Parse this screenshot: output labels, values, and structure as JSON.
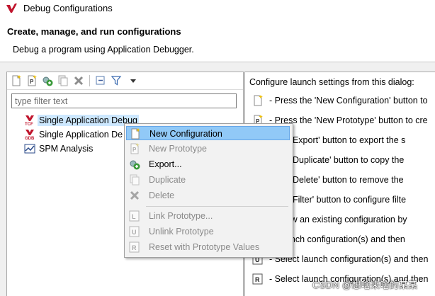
{
  "window": {
    "title": "Debug Configurations"
  },
  "header": {
    "title": "Create, manage, and run configurations",
    "subtitle": "Debug a program using Application Debugger."
  },
  "toolbar": {
    "icons": [
      "new-configuration-icon",
      "new-prototype-icon",
      "export-icon",
      "duplicate-icon",
      "delete-icon",
      "collapse-all-icon",
      "filter-icon",
      "view-menu-icon"
    ]
  },
  "filter": {
    "placeholder": "type filter text",
    "value": ""
  },
  "tree": {
    "items": [
      {
        "label": "Single Application Debug",
        "icon": "tcf-launch-icon",
        "selected": true
      },
      {
        "label": "Single Application De",
        "icon": "gdb-launch-icon",
        "selected": false
      },
      {
        "label": "SPM Analysis",
        "icon": "chart-icon",
        "selected": false
      }
    ]
  },
  "context_menu": {
    "items": [
      {
        "label": "New Configuration",
        "icon": "new-configuration-icon",
        "enabled": true,
        "highlighted": true
      },
      {
        "label": "New Prototype",
        "icon": "new-prototype-icon",
        "enabled": false
      },
      {
        "label": "Export...",
        "icon": "export-icon",
        "enabled": true
      },
      {
        "label": "Duplicate",
        "icon": "duplicate-icon",
        "enabled": false
      },
      {
        "label": "Delete",
        "icon": "delete-icon",
        "enabled": false
      },
      {
        "label": "Link Prototype...",
        "icon": "link-prototype-icon",
        "enabled": false
      },
      {
        "label": "Unlink Prototype",
        "icon": "unlink-prototype-icon",
        "enabled": false
      },
      {
        "label": "Reset with Prototype Values",
        "icon": "reset-prototype-icon",
        "enabled": false
      }
    ]
  },
  "help": {
    "heading": "Configure launch settings from this dialog:",
    "lines": [
      {
        "text": "- Press the 'New Configuration' button to",
        "icon": "new-configuration-icon"
      },
      {
        "text": "- Press the 'New Prototype' button to cre",
        "icon": "new-prototype-icon"
      },
      {
        "text": "s the 'Export' button to export the s",
        "icon": "export-icon"
      },
      {
        "text": "s the 'Duplicate' button to copy the",
        "icon": "duplicate-icon"
      },
      {
        "text": "s the 'Delete' button to remove the",
        "icon": "delete-icon"
      },
      {
        "text": "s the 'Filter' button to configure filte",
        "icon": "filter-icon"
      },
      {
        "text": "or view an existing configuration by",
        "icon": "edit-icon"
      },
      {
        "text": "ct launch configuration(s) and then",
        "icon": "link-prototype-icon"
      },
      {
        "text": "- Select launch configuration(s) and then",
        "icon": "unlink-prototype-icon"
      },
      {
        "text": "- Select launch configuration(s) and then",
        "icon": "reset-prototype-icon"
      }
    ]
  },
  "watermark": {
    "text": "CSDN @想啥来啥的某某"
  },
  "colors": {
    "menu_highlight": "#91c9f7",
    "selection": "#cde8ff",
    "disabled_text": "#8a8a8a"
  }
}
